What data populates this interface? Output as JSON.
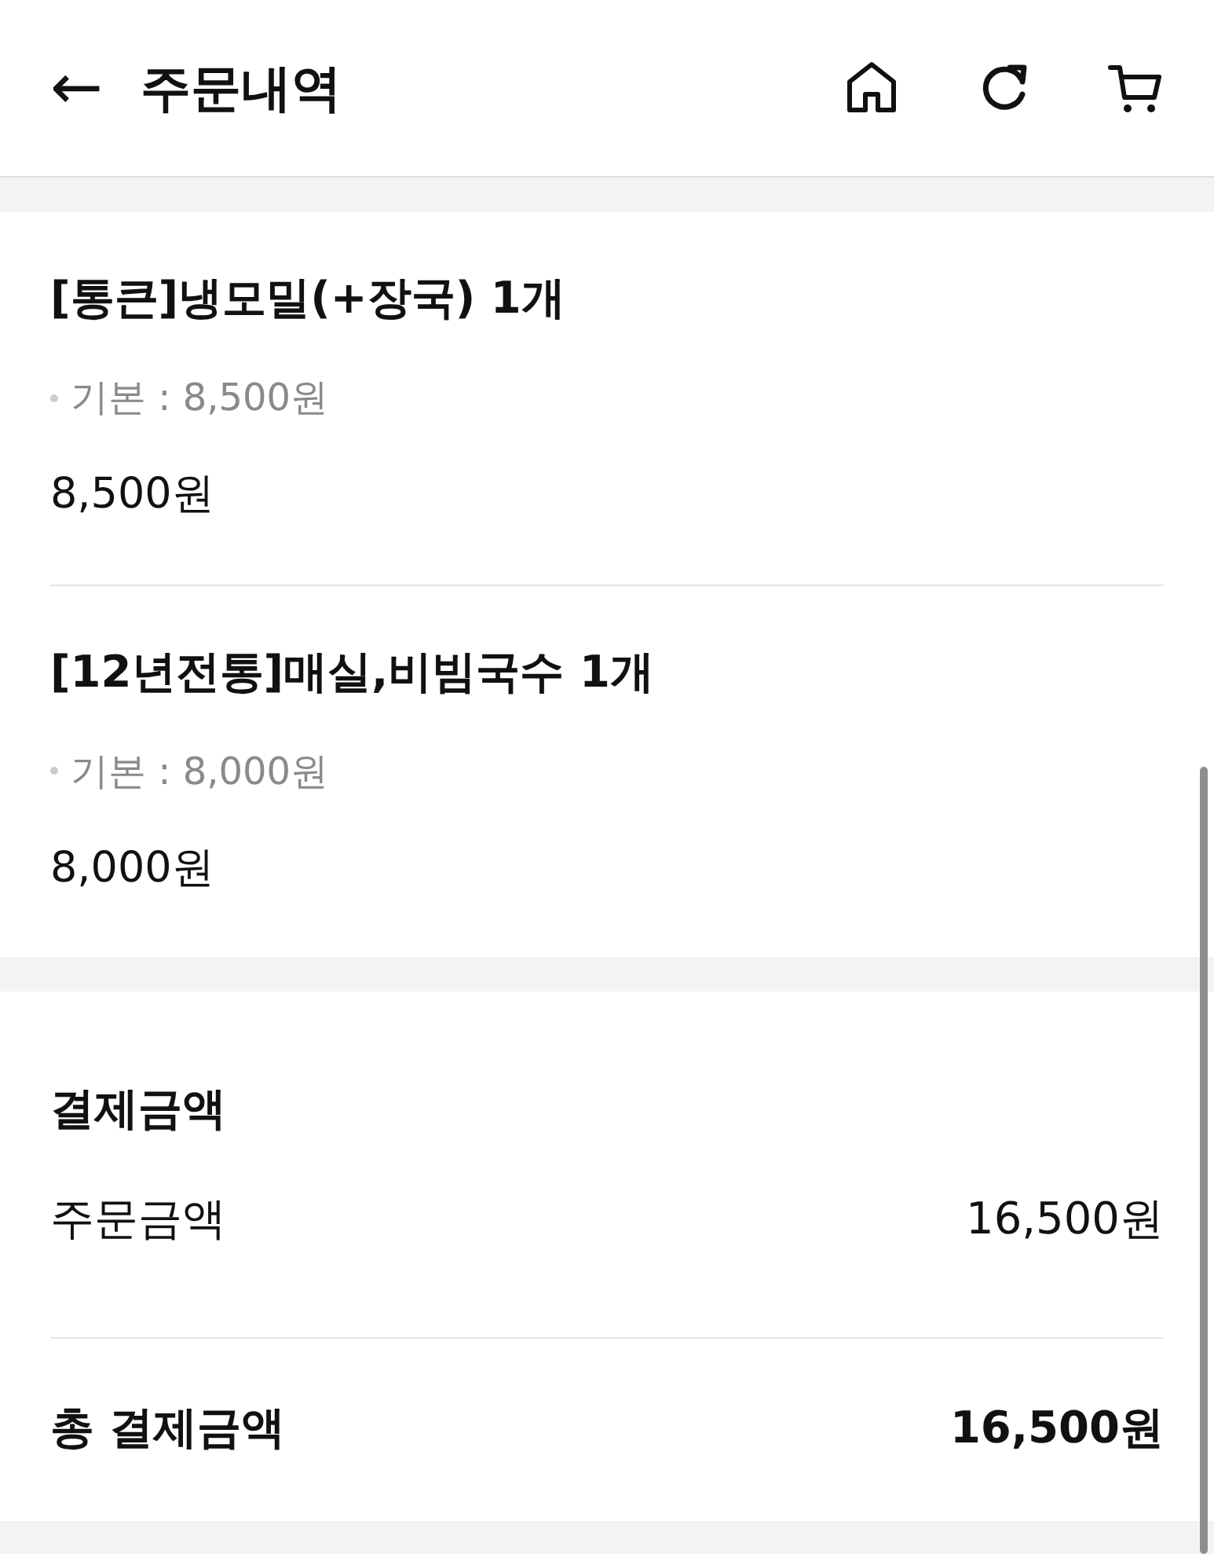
{
  "header": {
    "back": "←",
    "title": "주문내역"
  },
  "items": [
    {
      "name": "[통큰]냉모밀(+장국) 1개",
      "options": [
        "기본 : 8,500원"
      ],
      "price": "8,500원"
    },
    {
      "name": "[12년전통]매실,비빔국수 1개",
      "options": [
        "기본 : 8,000원"
      ],
      "price": "8,000원"
    }
  ],
  "payment": {
    "title": "결제금액",
    "rows": [
      {
        "label": "주문금액",
        "value": "16,500원"
      }
    ],
    "total": {
      "label": "총 결제금액",
      "value": "16,500원"
    }
  }
}
